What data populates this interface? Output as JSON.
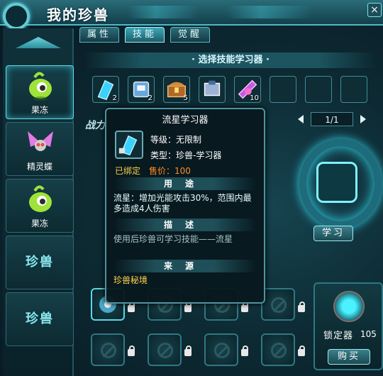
{
  "window": {
    "title": "我的珍兽",
    "close_label": "×"
  },
  "tabs": [
    {
      "label": "属性",
      "active": false
    },
    {
      "label": "技能",
      "active": true
    },
    {
      "label": "觉醒",
      "active": false
    }
  ],
  "sidebar": {
    "pets": [
      {
        "name": "果冻",
        "icon": "green-jelly-pet",
        "selected": true
      },
      {
        "name": "精灵蝶",
        "icon": "butterfly-pet",
        "selected": false
      },
      {
        "name": "果冻",
        "icon": "green-jelly-pet",
        "selected": false
      }
    ],
    "empty_slots": [
      {
        "label": "珍兽"
      },
      {
        "label": "珍兽"
      }
    ]
  },
  "skill_panel": {
    "section_title": "· 选择技能学习器 ·",
    "items": [
      {
        "icon": "blue-crystal-icon",
        "count": "2"
      },
      {
        "icon": "cube-device-icon",
        "count": "2"
      },
      {
        "icon": "treasure-chest-icon",
        "count": "5"
      },
      {
        "icon": "book-icon",
        "count": ""
      },
      {
        "icon": "purple-scroll-icon",
        "count": "10"
      },
      {
        "icon": "",
        "count": ""
      },
      {
        "icon": "",
        "count": ""
      },
      {
        "icon": "",
        "count": ""
      }
    ],
    "page": "1/1",
    "war_text": "战力",
    "learn_button": "学习"
  },
  "tooltip": {
    "title": "流星学习器",
    "level": "等级：无限制",
    "type": "类型：珍兽-学习器",
    "bound": "已绑定",
    "price": "售价：100",
    "usage_head": "用途",
    "usage_text": "流星：增加光能攻击30%，范围内最多造成4人伤害",
    "desc_head": "描述",
    "desc_text": "使用后珍兽可学习技能——流星",
    "source_head": "来源",
    "source_text": "珍兽秘境"
  },
  "locker": {
    "label": "锁定器",
    "count": "105",
    "buy_button": "购买"
  }
}
